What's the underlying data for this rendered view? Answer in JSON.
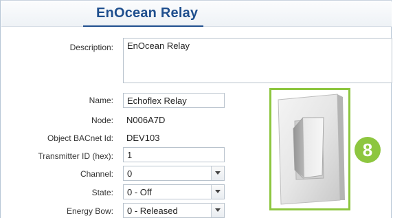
{
  "header": {
    "title": "EnOcean Relay"
  },
  "form": {
    "description": {
      "label": "Description:",
      "value": "EnOcean Relay"
    },
    "name": {
      "label": "Name:",
      "value": "Echoflex Relay"
    },
    "node": {
      "label": "Node:",
      "value": "N006A7D"
    },
    "object_bacnet_id": {
      "label": "Object BACnet Id:",
      "value": "DEV103"
    },
    "transmitter_id": {
      "label": "Transmitter ID (hex):",
      "value": "1"
    },
    "channel": {
      "label": "Channel:",
      "value": "0"
    },
    "state": {
      "label": "State:",
      "value": "0 - Off"
    },
    "energy_bow": {
      "label": "Energy Bow:",
      "value": "0 - Released"
    }
  },
  "callout": {
    "number": "8"
  },
  "colors": {
    "title": "#1f4f8e",
    "highlight": "#8dc63f"
  }
}
